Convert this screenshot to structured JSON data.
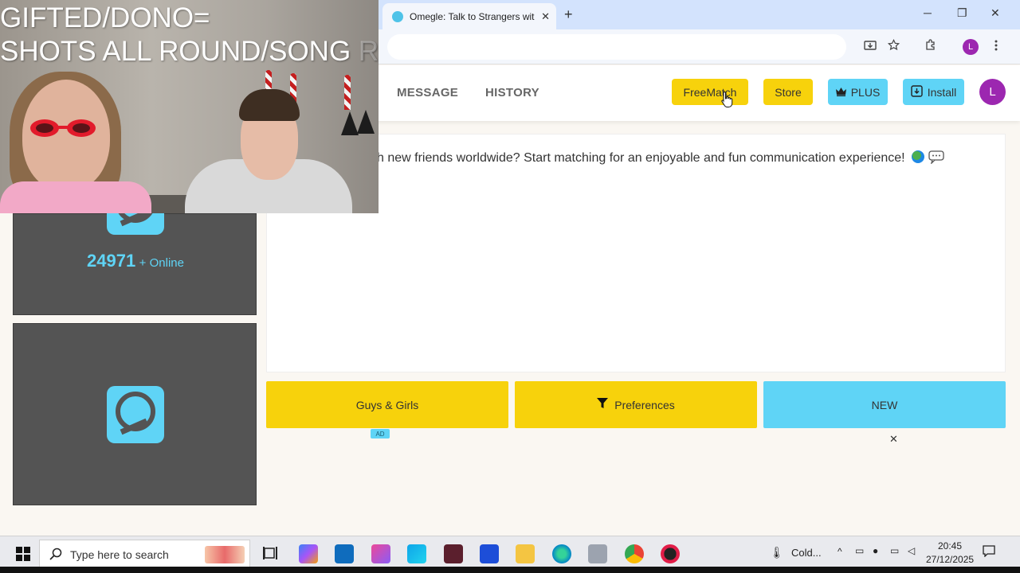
{
  "browser": {
    "tab_title": "Omegle: Talk to Strangers with",
    "new_tab": "+",
    "tab_close": "✕",
    "window_controls": {
      "minimize": "─",
      "restore": "❐",
      "close": "✕"
    },
    "profile_initial": "L",
    "toolbar_icons": [
      "install-app-icon",
      "star-icon",
      "extensions-icon",
      "menu-icon"
    ]
  },
  "header": {
    "nav": {
      "message": "MESSAGE",
      "history": "HISTORY"
    },
    "buttons": {
      "freematch": "FreeMatch",
      "store": "Store",
      "plus": "PLUS",
      "install": "Install"
    },
    "avatar_initial": "L"
  },
  "chat": {
    "welcome": "ith new friends worldwide? Start matching for an enjoyable and fun communication experience!"
  },
  "actions": {
    "gender": "Guys & Girls",
    "preferences": "Preferences",
    "new": "NEW",
    "ad_badge": "AD",
    "close": "✕"
  },
  "sidebar": {
    "online_count": "24971",
    "online_label": "+ Online"
  },
  "webcam": {
    "line1": "GIFTED/DONO=",
    "line2": "SHOTS ALL ROUND/SONG",
    "line2_faded": "REQ"
  },
  "taskbar": {
    "search_placeholder": "Type here to search",
    "weather": "Cold...",
    "time": "20:45",
    "date": "27/12/2025"
  },
  "colors": {
    "yellow": "#f7d20c",
    "cyan": "#5fd4f6",
    "panel": "#545454",
    "avatar": "#9c27b0"
  }
}
